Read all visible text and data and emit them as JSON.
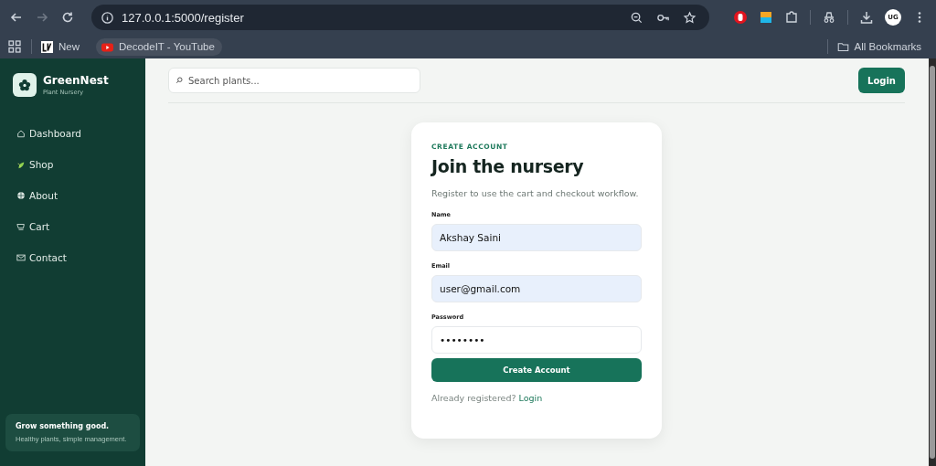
{
  "browser": {
    "url": "127.0.0.1:5000/register",
    "bookmarks": [
      {
        "label": "New",
        "kind": "logo"
      },
      {
        "label": "DecodeIT - YouTube",
        "kind": "video"
      }
    ],
    "all_bookmarks": "All Bookmarks",
    "profile": "UG"
  },
  "sidebar": {
    "brand": "GreenNest",
    "tagline": "Plant Nursery",
    "items": [
      {
        "label": "Dashboard",
        "kind": "home"
      },
      {
        "label": "Shop",
        "kind": "leaf"
      },
      {
        "label": "About",
        "kind": "globe"
      },
      {
        "label": "Cart",
        "kind": "cart"
      },
      {
        "label": "Contact",
        "kind": "mail"
      }
    ],
    "promo": {
      "title": "Grow something good.",
      "text": "Healthy plants, simple management."
    }
  },
  "topbar": {
    "search": {
      "placeholder": "Search plants..."
    },
    "login": "Login"
  },
  "card": {
    "eyebrow": "CREATE ACCOUNT",
    "title": "Join the nursery",
    "subtitle": "Register to use the cart and checkout workflow.",
    "fields": [
      {
        "label": "Name",
        "value": "Akshay Saini",
        "autofilled": true
      },
      {
        "label": "Email",
        "value": "user@gmail.com",
        "autofilled": true
      },
      {
        "label": "Password",
        "value": "••••••••",
        "autofilled": false
      }
    ],
    "submit": "Create Account",
    "footer": "Already registered?",
    "footer_link": "Login"
  }
}
